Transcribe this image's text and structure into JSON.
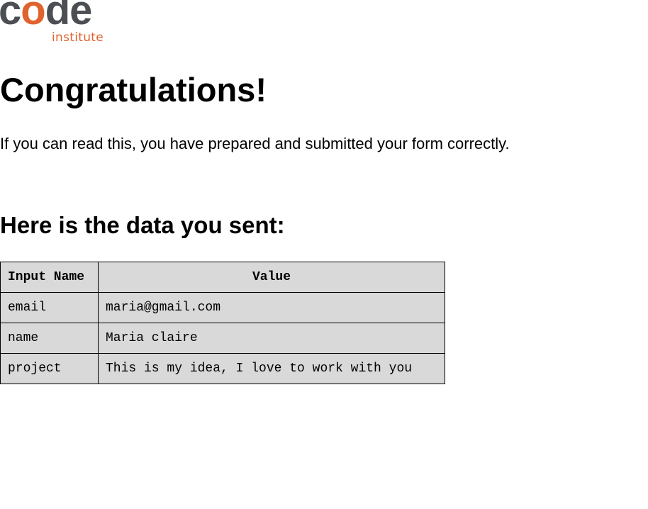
{
  "logo": {
    "word_start": "c",
    "word_accent": "o",
    "word_end": "de",
    "subtitle": "institute",
    "colors": {
      "dark": "#4b4f54",
      "accent": "#e0622d"
    }
  },
  "heading": "Congratulations!",
  "intro": "If you can read this, you have prepared and submitted your form correctly.",
  "subheading": "Here is the data you sent:",
  "table": {
    "headers": [
      "Input Name",
      "Value"
    ],
    "rows": [
      [
        "email",
        "maria@gmail.com"
      ],
      [
        "name",
        "Maria claire"
      ],
      [
        "project",
        "This is my idea, I love to work with you"
      ]
    ]
  }
}
